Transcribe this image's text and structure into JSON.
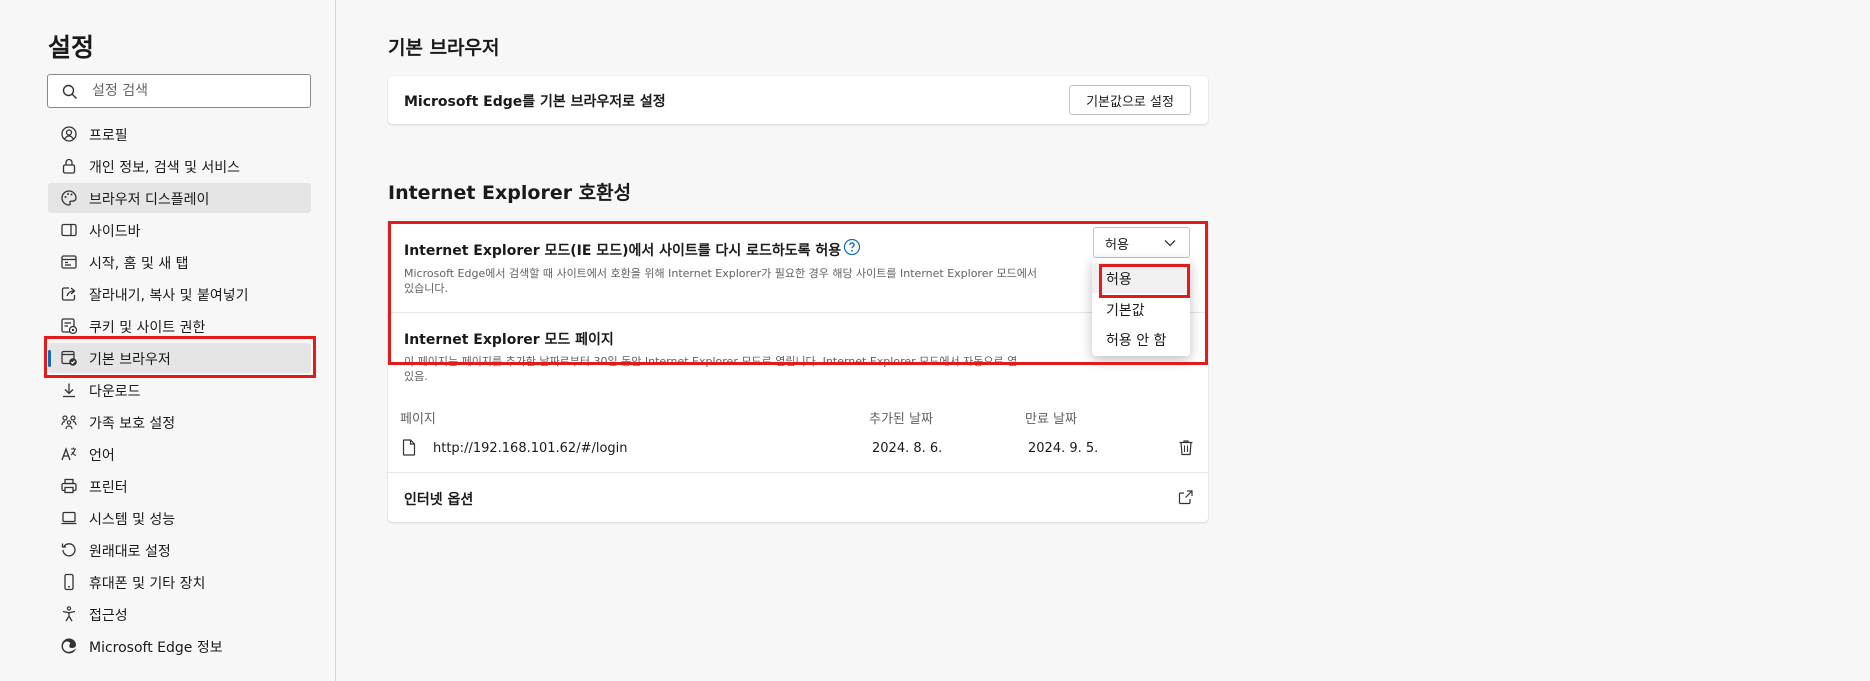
{
  "sidebar": {
    "title": "설정",
    "search_placeholder": "설정 검색",
    "items": [
      {
        "label": "프로필",
        "icon": "profile-icon"
      },
      {
        "label": "개인 정보, 검색 및 서비스",
        "icon": "lock-icon"
      },
      {
        "label": "브라우저 디스플레이",
        "icon": "palette-icon"
      },
      {
        "label": "사이드바",
        "icon": "sidebar-icon"
      },
      {
        "label": "시작, 홈 및 새 탭",
        "icon": "home-tab-icon"
      },
      {
        "label": "잘라내기, 복사 및 붙여넣기",
        "icon": "share-icon"
      },
      {
        "label": "쿠키 및 사이트 권한",
        "icon": "cookie-icon"
      },
      {
        "label": "기본 브라우저",
        "icon": "default-browser-icon"
      },
      {
        "label": "다운로드",
        "icon": "download-icon"
      },
      {
        "label": "가족 보호 설정",
        "icon": "family-icon"
      },
      {
        "label": "언어",
        "icon": "language-icon"
      },
      {
        "label": "프린터",
        "icon": "printer-icon"
      },
      {
        "label": "시스템 및 성능",
        "icon": "laptop-icon"
      },
      {
        "label": "원래대로 설정",
        "icon": "reset-icon"
      },
      {
        "label": "휴대폰 및 기타 장치",
        "icon": "phone-icon"
      },
      {
        "label": "접근성",
        "icon": "accessibility-icon"
      },
      {
        "label": "Microsoft Edge 정보",
        "icon": "edge-logo-icon"
      }
    ]
  },
  "default_browser": {
    "heading": "기본 브라우저",
    "row_label": "Microsoft Edge를 기본 브라우저로 설정",
    "button_label": "기본값으로 설정"
  },
  "ie_compat": {
    "heading": "Internet Explorer 호환성",
    "reload": {
      "title": "Internet Explorer 모드(IE 모드)에서 사이트를 다시 로드하도록 허용",
      "desc_line1": "Microsoft Edge에서 검색할 때 사이트에서 호환을 위해 Internet Explorer가 필요한 경우 해당 사이트를 Internet Explorer 모드에서",
      "desc_line2": "있습니다.",
      "selected": "허용",
      "options": [
        "허용",
        "기본값",
        "허용 안 함"
      ]
    },
    "pages": {
      "title": "Internet Explorer 모드 페이지",
      "desc_line1": "이 페이지는 페이지를 추가한 날짜로부터 30일 동안 Internet Explorer 모드로 열립니다. Internet Explorer 모드에서 자동으로 열",
      "desc_line2": "있음.",
      "col_page": "페이지",
      "col_added": "추가된 날짜",
      "col_expires": "만료 날짜",
      "rows": [
        {
          "url": "http://192.168.101.62/#/login",
          "added": "2024. 8. 6.",
          "expires": "2024. 9. 5."
        }
      ]
    },
    "internet_options": "인터넷 옵션"
  },
  "colors": {
    "accent": "#0f6cbd",
    "highlight": "#e01b1b"
  }
}
